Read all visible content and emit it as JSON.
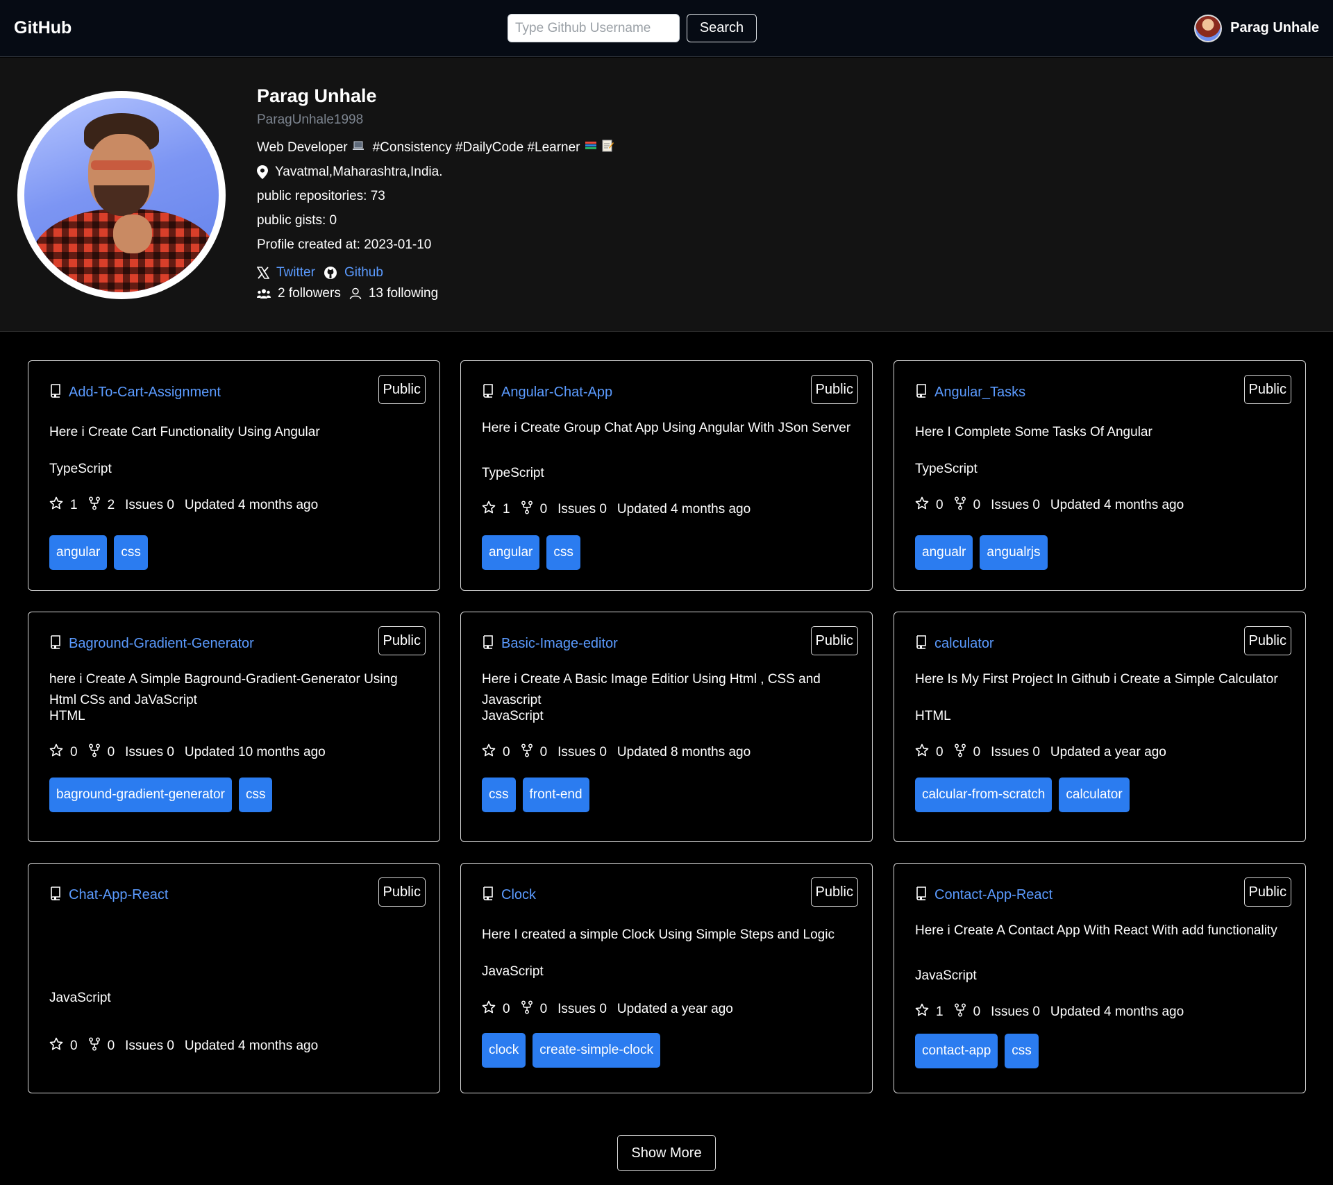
{
  "nav": {
    "brand": "GitHub",
    "search_placeholder": "Type Github Username",
    "search_button": "Search",
    "user_name": "Parag Unhale"
  },
  "profile": {
    "name": "Parag Unhale",
    "login": "ParagUnhale1998",
    "bio": "Web Developer",
    "bio_tags": "#Consistency #DailyCode #Learner",
    "location": "Yavatmal,Maharashtra,India.",
    "public_repos": "public repositories: 73",
    "public_gists": "public gists: 0",
    "created": "Profile created at: 2023-01-10",
    "twitter_label": "Twitter",
    "github_label": "Github",
    "followers": "2 followers",
    "following": "13 following"
  },
  "repos": [
    {
      "name": "Add-To-Cart-Assignment",
      "visibility": "Public",
      "description": "Here i Create Cart Functionality Using Angular",
      "language": "TypeScript",
      "stars": "1",
      "forks": "2",
      "issues": "Issues 0",
      "updated": "Updated 4 months ago",
      "topics": [
        "angular",
        "css"
      ]
    },
    {
      "name": "Angular-Chat-App",
      "visibility": "Public",
      "description": "Here i Create Group Chat App Using Angular With JSon Server",
      "language": "TypeScript",
      "stars": "1",
      "forks": "0",
      "issues": "Issues 0",
      "updated": "Updated 4 months ago",
      "topics": [
        "angular",
        "css"
      ]
    },
    {
      "name": "Angular_Tasks",
      "visibility": "Public",
      "description": "Here I Complete Some Tasks Of Angular",
      "language": "TypeScript",
      "stars": "0",
      "forks": "0",
      "issues": "Issues 0",
      "updated": "Updated 4 months ago",
      "topics": [
        "angualr",
        "angualrjs"
      ]
    },
    {
      "name": "Baground-Gradient-Generator",
      "visibility": "Public",
      "description": "here i Create A Simple Baground-Gradient-Generator Using Html CSs and JaVaScript",
      "language": "HTML",
      "stars": "0",
      "forks": "0",
      "issues": "Issues 0",
      "updated": "Updated 10 months ago",
      "topics": [
        "baground-gradient-generator",
        "css"
      ]
    },
    {
      "name": "Basic-Image-editor",
      "visibility": "Public",
      "description": "Here i Create A Basic Image Editior Using Html , CSS and Javascript",
      "language": "JavaScript",
      "stars": "0",
      "forks": "0",
      "issues": "Issues 0",
      "updated": "Updated 8 months ago",
      "topics": [
        "css",
        "front-end"
      ]
    },
    {
      "name": "calculator",
      "visibility": "Public",
      "description": "Here Is My First Project In Github i Create a Simple Calculator",
      "language": "HTML",
      "stars": "0",
      "forks": "0",
      "issues": "Issues 0",
      "updated": "Updated a year ago",
      "topics": [
        "calcular-from-scratch",
        "calculator"
      ]
    },
    {
      "name": "Chat-App-React",
      "visibility": "Public",
      "description": "",
      "language": "JavaScript",
      "stars": "0",
      "forks": "0",
      "issues": "Issues 0",
      "updated": "Updated 4 months ago",
      "topics": []
    },
    {
      "name": "Clock",
      "visibility": "Public",
      "description": "Here I created a simple Clock Using Simple Steps and Logic",
      "language": "JavaScript",
      "stars": "0",
      "forks": "0",
      "issues": "Issues 0",
      "updated": "Updated a year ago",
      "topics": [
        "clock",
        "create-simple-clock"
      ]
    },
    {
      "name": "Contact-App-React",
      "visibility": "Public",
      "description": "Here i Create A Contact App With React With add functionality",
      "language": "JavaScript",
      "stars": "1",
      "forks": "0",
      "issues": "Issues 0",
      "updated": "Updated 4 months ago",
      "topics": [
        "contact-app",
        "css"
      ]
    }
  ],
  "show_more": "Show More"
}
